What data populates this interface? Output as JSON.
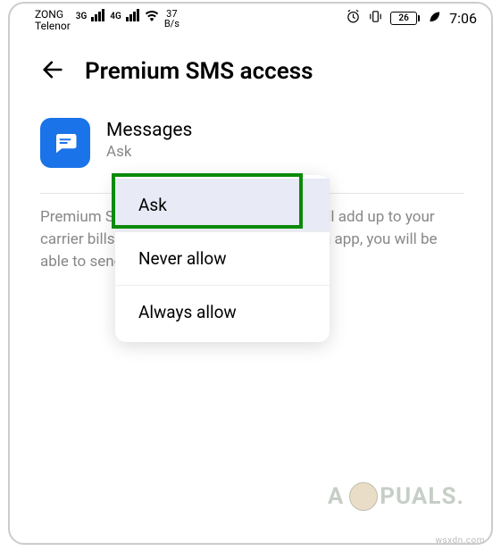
{
  "statusbar": {
    "carrier1": "ZONG",
    "carrier2": "Telenor",
    "net1": "3G",
    "net2": "4G",
    "data_rate_num": "37",
    "data_rate_unit": "B/s",
    "battery_pct": "26",
    "clock": "7:06"
  },
  "header": {
    "title": "Premium SMS access"
  },
  "app": {
    "name": "Messages",
    "status": "Ask"
  },
  "description": "Premium SMS may cost you money and will add up to your carrier bills. If you enable permission for an app, you will be able to send premium SMS using that app.",
  "popup": {
    "items": [
      {
        "label": "Ask",
        "selected": true
      },
      {
        "label": "Never allow",
        "selected": false
      },
      {
        "label": "Always allow",
        "selected": false
      }
    ]
  },
  "watermark": {
    "site": "wsxdn.com",
    "logo_text_a": "A",
    "logo_text_b": "PUALS."
  }
}
